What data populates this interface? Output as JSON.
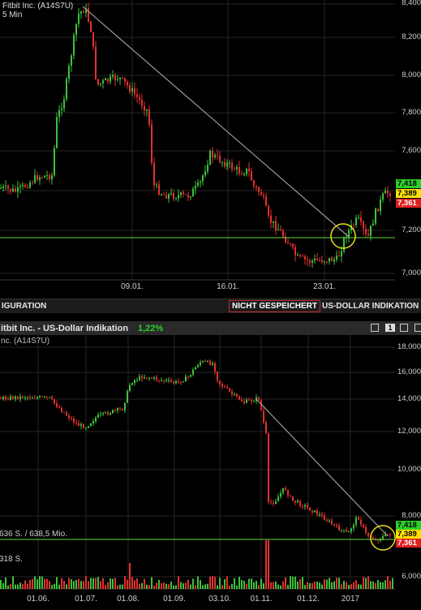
{
  "top_chart": {
    "instrument": "Fitbit Inc. (A14S7U)",
    "interval": "5 Min",
    "y_ticks": [
      "8,400",
      "8,200",
      "8,000",
      "7,800",
      "7,600",
      "7,400",
      "7,200",
      "7,000"
    ],
    "x_ticks": [
      "09.01.",
      "16.01.",
      "23.01."
    ],
    "price_tags": [
      {
        "value": "7,418",
        "color": "#2bd02b",
        "text": "#000000"
      },
      {
        "value": "7,389",
        "color": "#ffe000",
        "text": "#000000"
      },
      {
        "value": "7,361",
        "color": "#e02020",
        "text": "#ffffff"
      }
    ]
  },
  "toolbar": {
    "left_label": "IGURATION",
    "save_status": "NICHT GESPEICHERT",
    "quote_source": "US-DOLLAR INDIKATION ▲"
  },
  "bottom_panel": {
    "title": "itbit Inc. - US-Dollar Indikation",
    "change": "1,22%",
    "change_color": "#2bd02b",
    "window_number": "1",
    "instrument_line": "nc. (A14S7U)",
    "volume_avg": "636 S. / 638,5 Mio.",
    "volume_last": "318 S.",
    "y_ticks": [
      "18,000",
      "16,000",
      "14,000",
      "12,000",
      "10,000",
      "8,000",
      "6,000"
    ],
    "x_ticks": [
      "01.06.",
      "01.07.",
      "01.08.",
      "01.09.",
      "03.10.",
      "01.11.",
      "01.12.",
      "2017"
    ],
    "price_tags": [
      {
        "value": "7,418",
        "color": "#2bd02b",
        "text": "#000000"
      },
      {
        "value": "7,389",
        "color": "#ffe000",
        "text": "#000000"
      },
      {
        "value": "7,361",
        "color": "#e02020",
        "text": "#ffffff"
      }
    ]
  },
  "colors": {
    "up": "#3cc23c",
    "down": "#e23030",
    "support": "#66dd33",
    "trend": "#9a9a9a",
    "highlight": "#e8e020"
  }
}
